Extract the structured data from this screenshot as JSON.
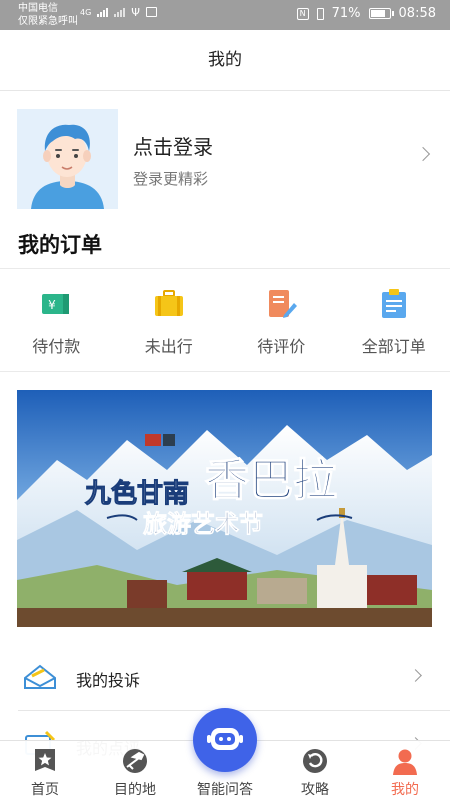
{
  "status_bar": {
    "carrier_line1": "中国电信",
    "carrier_line2": "仅限紧急呼叫",
    "network": "4G",
    "battery": "71%",
    "time": "08:58"
  },
  "header": {
    "title": "我的"
  },
  "profile": {
    "login_title": "点击登录",
    "login_subtitle": "登录更精彩",
    "avatar_icon": "user-avatar-icon"
  },
  "orders": {
    "title": "我的订单",
    "items": [
      {
        "label": "待付款",
        "icon": "wallet-yen-icon",
        "color": "#2bb58a"
      },
      {
        "label": "未出行",
        "icon": "suitcase-icon",
        "color": "#f5c518"
      },
      {
        "label": "待评价",
        "icon": "note-pen-icon",
        "color": "#f08a5d"
      },
      {
        "label": "全部订单",
        "icon": "clipboard-icon",
        "color": "#5aa8ee"
      }
    ]
  },
  "banner": {
    "line1": "九色甘南",
    "line2": "香巴拉",
    "line3": "旅游艺术节"
  },
  "menu": [
    {
      "label": "我的投诉",
      "icon": "complaint-envelope-icon"
    },
    {
      "label": "我的点评",
      "icon": "review-icon"
    }
  ],
  "tabbar": {
    "tabs": [
      {
        "label": "首页",
        "icon": "star-badge-icon"
      },
      {
        "label": "目的地",
        "icon": "plane-globe-icon"
      },
      {
        "label": "智能问答",
        "icon": "robot-icon"
      },
      {
        "label": "攻略",
        "icon": "compass-icon"
      },
      {
        "label": "我的",
        "icon": "person-icon"
      }
    ],
    "active_color": "#f26b50",
    "fab_color": "#3f63e8"
  }
}
